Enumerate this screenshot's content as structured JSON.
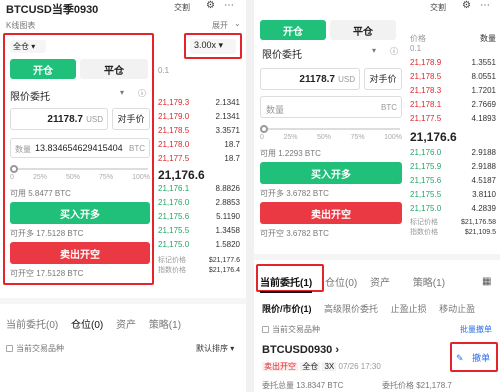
{
  "left": {
    "title": "BTCUSD当季0930",
    "exchange": "交割",
    "chart_label": "K线图表",
    "expand": "展开",
    "margin_mode": "全仓",
    "leverage": "3.00x",
    "tabs": [
      "开仓",
      "平仓"
    ],
    "order_type": "限价委托",
    "price_value": "21178.7",
    "price_unit": "USD",
    "counter_price": "对手价",
    "qty_label": "数量",
    "qty_value": "13.834654629415404",
    "qty_unit": "BTC",
    "slider_ticks": [
      "0",
      "25%",
      "50%",
      "75%",
      "100%"
    ],
    "avail_1": "可用 5.8477 BTC",
    "buy_label": "买入开多",
    "buy_open": "可开多 17.5128 BTC",
    "sell_label": "卖出开空",
    "sell_open": "可开空 17.5128 BTC",
    "book_header": "0.1",
    "asks": [
      {
        "p": "21,179.3",
        "q": "2.1341"
      },
      {
        "p": "21,179.0",
        "q": "2.1341"
      },
      {
        "p": "21,178.5",
        "q": "3.3571"
      },
      {
        "p": "21,178.0",
        "q": "18.7"
      },
      {
        "p": "21,177.5",
        "q": "18.7"
      }
    ],
    "mid_price": "21,176.6",
    "bids": [
      {
        "p": "21,176.1",
        "q": "8.8826"
      },
      {
        "p": "21,176.0",
        "q": "2.8853"
      },
      {
        "p": "21,175.6",
        "q": "5.1190"
      },
      {
        "p": "21,175.5",
        "q": "1.3458"
      },
      {
        "p": "21,175.0",
        "q": "1.5820"
      }
    ],
    "mark_label": "标记价格",
    "mark_value": "$21,177.6",
    "index_label": "指数价格",
    "index_value": "$21,176.4",
    "bottom_tabs": [
      "当前委托(0)",
      "仓位(0)",
      "资产",
      "策略(1)"
    ],
    "filter_label": "当前交易品种",
    "sort_label": "默认排序"
  },
  "right": {
    "exchange": "交割",
    "tabs": [
      "开仓",
      "平仓"
    ],
    "order_type": "限价委托",
    "price_value": "21178.7",
    "price_unit": "USD",
    "counter_price": "对手价",
    "qty_label": "数量",
    "qty_unit": "BTC",
    "slider_ticks": [
      "0",
      "25%",
      "50%",
      "75%",
      "100%"
    ],
    "avail": "可用 1.2293 BTC",
    "buy_label": "买入开多",
    "buy_open": "可开多 3.6782 BTC",
    "sell_label": "卖出开空",
    "sell_open": "可开空 3.6782 BTC",
    "book_header_l": "价格",
    "book_header_r": "数量",
    "book_sub": "0.1",
    "asks": [
      {
        "p": "21,178.9",
        "q": "1.3551"
      },
      {
        "p": "21,178.5",
        "q": "8.0551"
      },
      {
        "p": "21,178.3",
        "q": "1.7201"
      },
      {
        "p": "21,178.1",
        "q": "2.7669"
      },
      {
        "p": "21,177.5",
        "q": "4.1893"
      }
    ],
    "mid_price": "21,176.6",
    "bids": [
      {
        "p": "21,176.0",
        "q": "2.9188"
      },
      {
        "p": "21,175.9",
        "q": "2.9188"
      },
      {
        "p": "21,175.6",
        "q": "4.5187"
      },
      {
        "p": "21,175.5",
        "q": "3.8110"
      },
      {
        "p": "21,175.0",
        "q": "4.2839"
      }
    ],
    "mark_label": "标记价格",
    "mark_value": "$21,176.58",
    "index_label": "指数价格",
    "index_value": "$21,109.5",
    "bottom_tabs": [
      "当前委托(1)",
      "仓位(0)",
      "资产",
      "策略(1)"
    ],
    "sub_tabs": [
      "限价/市价(1)",
      "高级限价委托",
      "止盈止损",
      "移动止盈"
    ],
    "filter_label": "当前交易品种",
    "batch_cancel": "批量撤单",
    "order_title": "BTCUSD0930",
    "order_side": "卖出开空",
    "order_mode": "全仓",
    "order_lev": "3X",
    "order_time": "07/26 17:30",
    "cancel_label": "撤单",
    "order_qty": "委托总量 13.8347 BTC",
    "order_price": "委托价格 $21,178.7"
  }
}
